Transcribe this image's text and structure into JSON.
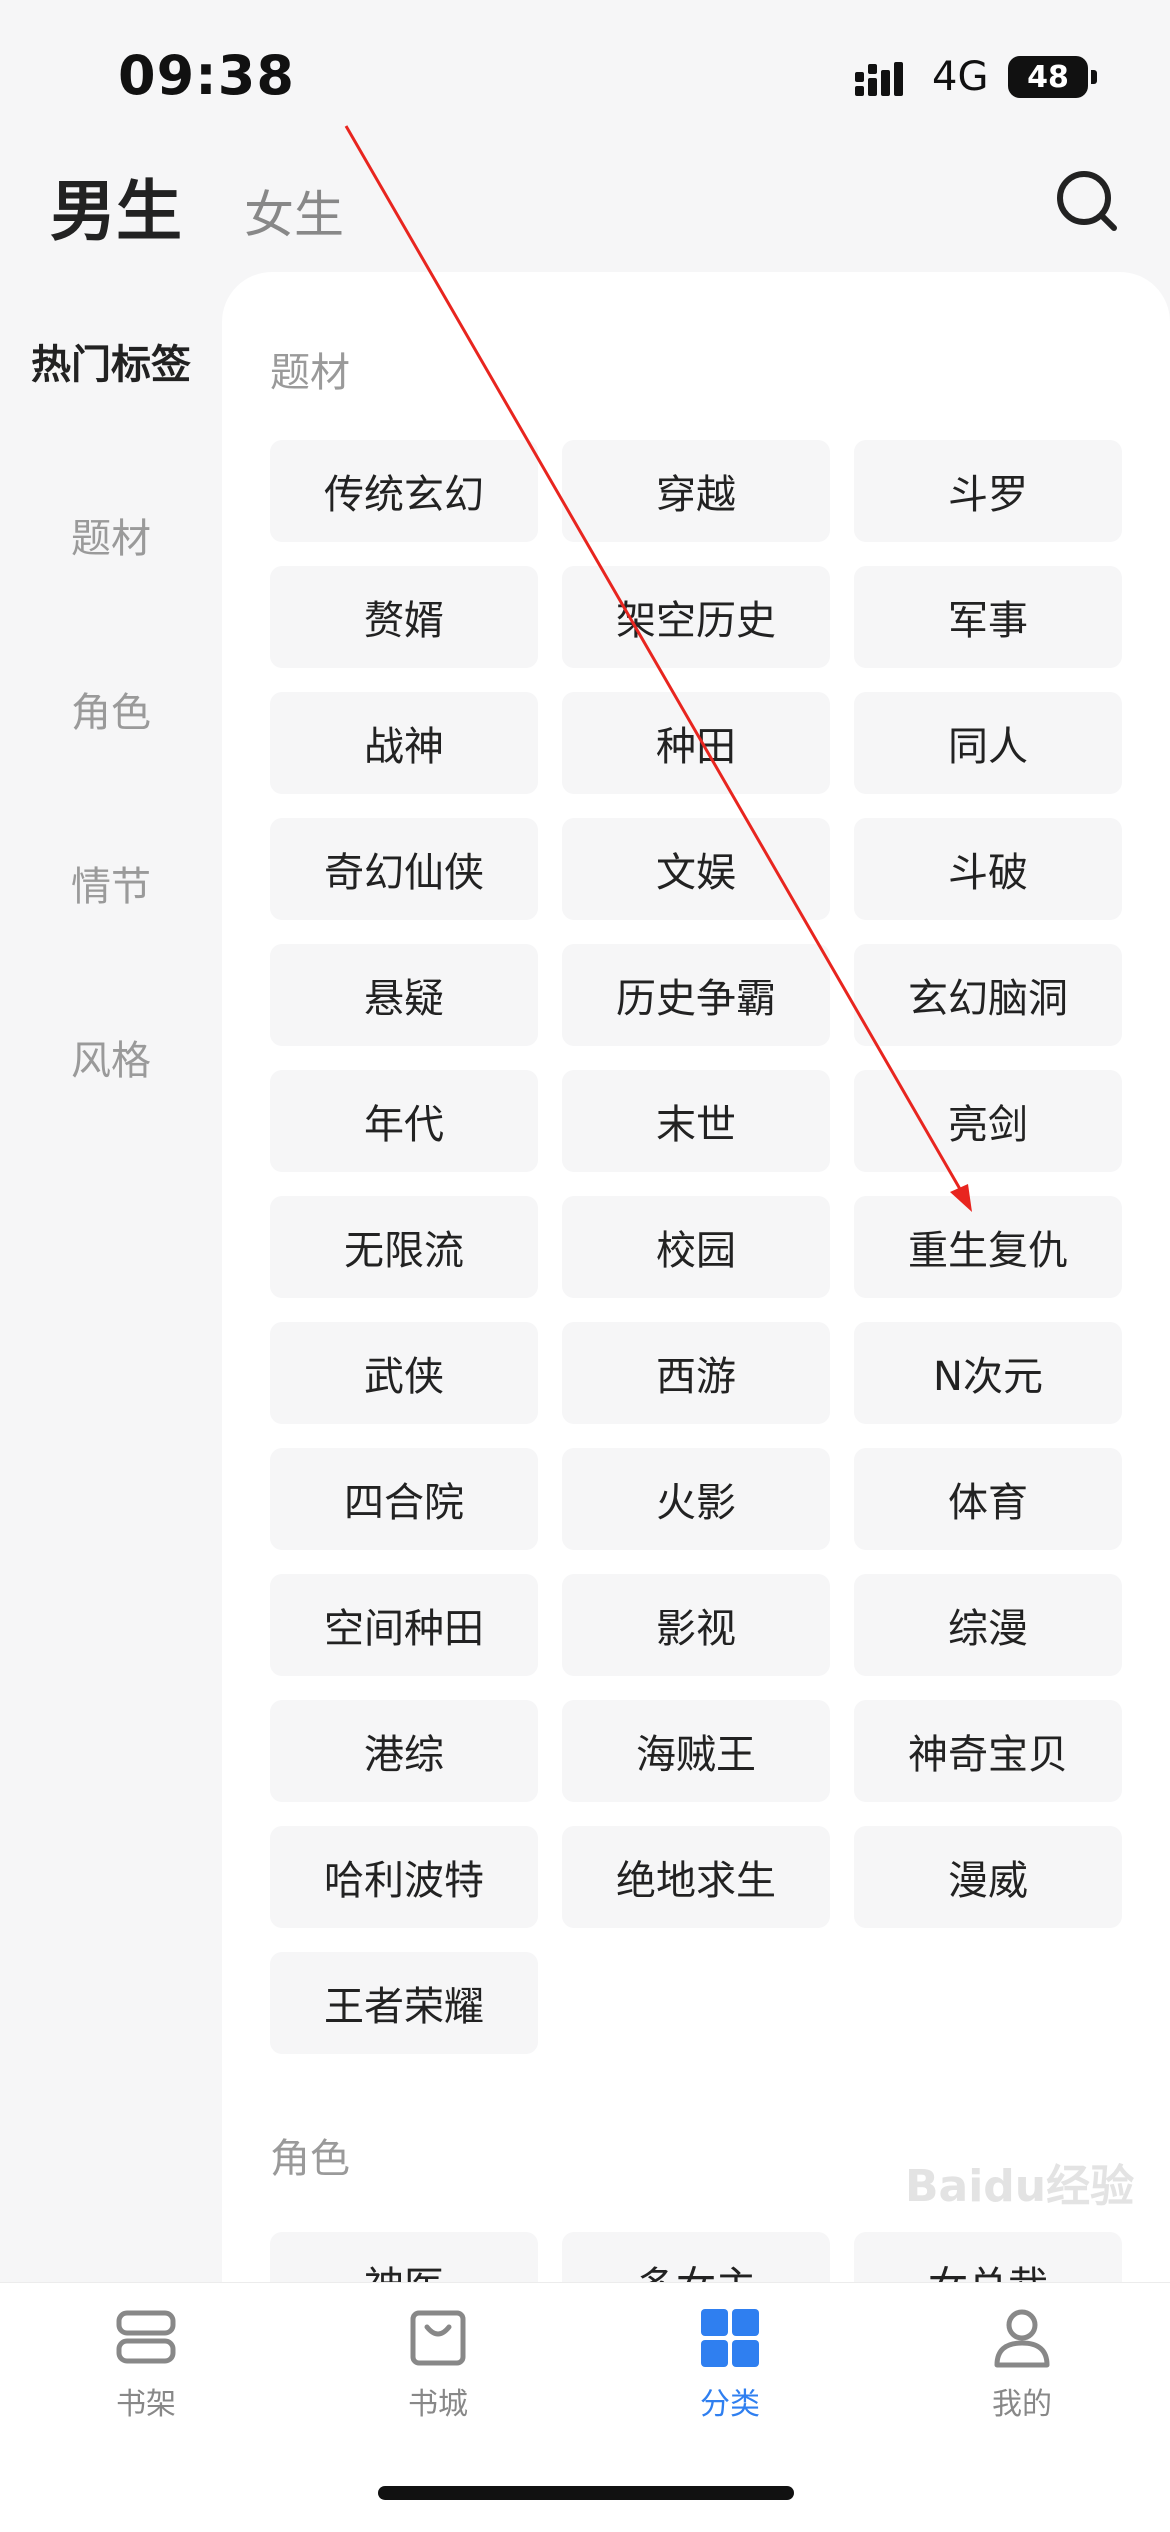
{
  "status_bar": {
    "time": "09:38",
    "network": "4G",
    "battery": "48"
  },
  "header": {
    "tab_male": "男生",
    "tab_female": "女生",
    "search_icon": "search-icon"
  },
  "sidebar": {
    "items": [
      {
        "label": "热门标签",
        "active": true
      },
      {
        "label": "题材",
        "active": false
      },
      {
        "label": "角色",
        "active": false
      },
      {
        "label": "情节",
        "active": false
      },
      {
        "label": "风格",
        "active": false
      }
    ]
  },
  "sections": [
    {
      "title": "题材",
      "tags": [
        "传统玄幻",
        "穿越",
        "斗罗",
        "赘婿",
        "架空历史",
        "军事",
        "战神",
        "种田",
        "同人",
        "奇幻仙侠",
        "文娱",
        "斗破",
        "悬疑",
        "历史争霸",
        "玄幻脑洞",
        "年代",
        "末世",
        "亮剑",
        "无限流",
        "校园",
        "重生复仇",
        "武侠",
        "西游",
        "N次元",
        "四合院",
        "火影",
        "体育",
        "空间种田",
        "影视",
        "综漫",
        "港综",
        "海贼王",
        "神奇宝贝",
        "哈利波特",
        "绝地求生",
        "漫威",
        "王者荣耀"
      ]
    },
    {
      "title": "角色",
      "tags": [
        "神医",
        "多女主",
        "女总裁"
      ]
    }
  ],
  "bottom_nav": {
    "items": [
      {
        "label": "书架",
        "icon": "bookshelf-icon",
        "active": false
      },
      {
        "label": "书城",
        "icon": "bookstore-bag-icon",
        "active": false
      },
      {
        "label": "分类",
        "icon": "category-grid-icon",
        "active": true
      },
      {
        "label": "我的",
        "icon": "profile-icon",
        "active": false
      }
    ]
  },
  "watermark": "Baidu经验",
  "colors": {
    "accent": "#2f7ff0",
    "annotation": "#e8251f",
    "tag_bg": "#f6f6f7"
  }
}
